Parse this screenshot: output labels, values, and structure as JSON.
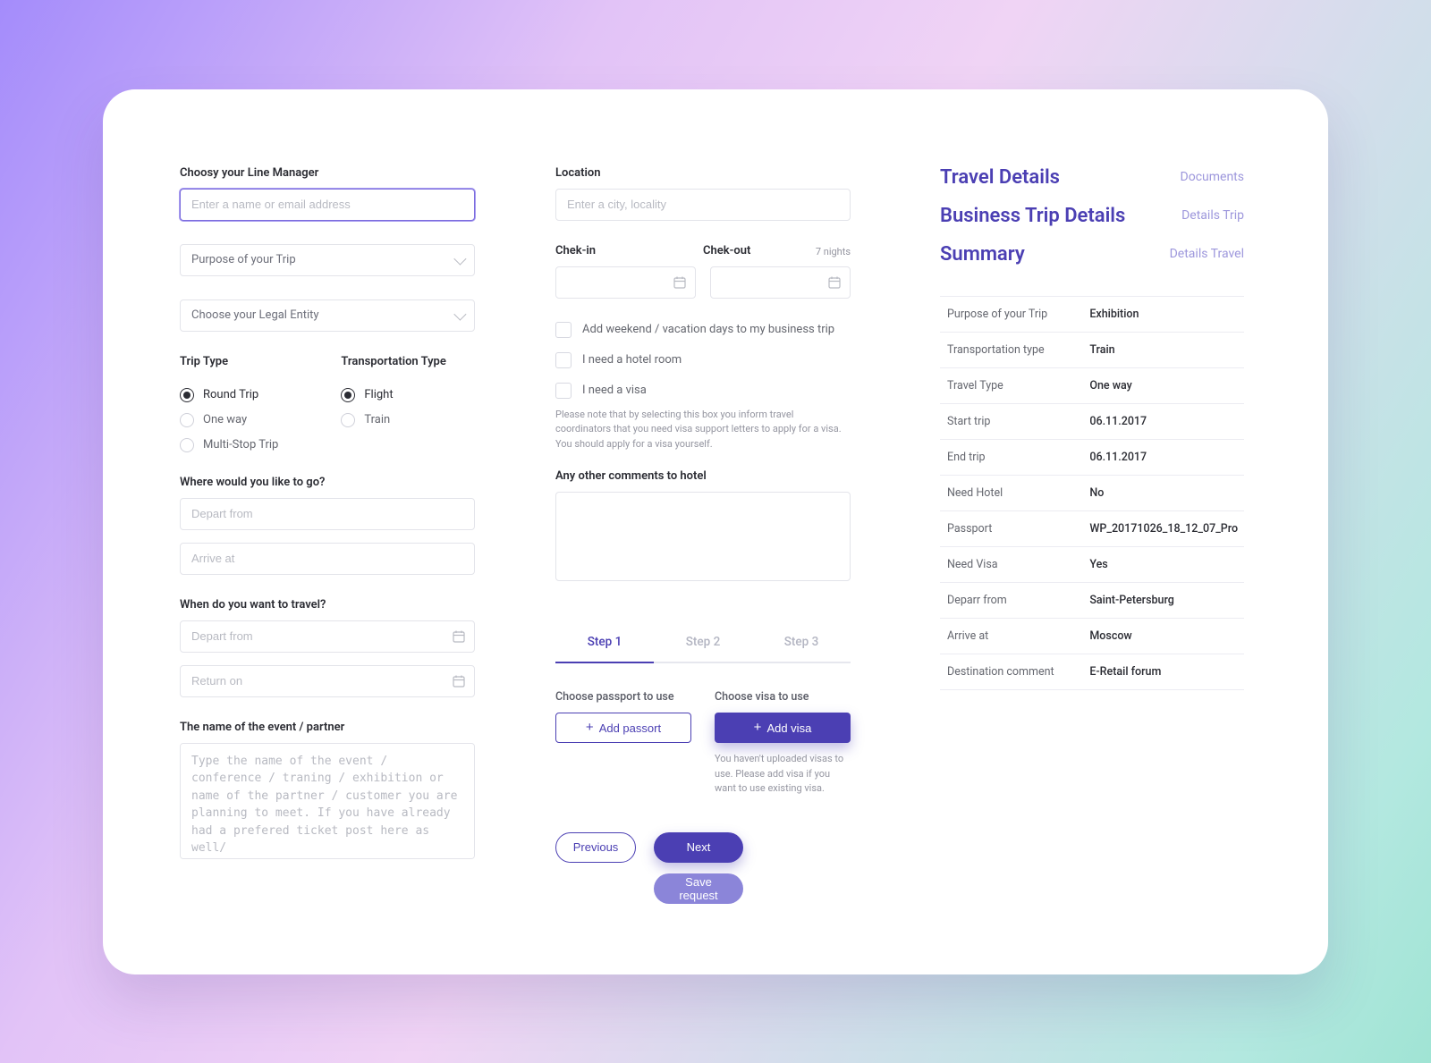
{
  "left": {
    "lineManager": {
      "label": "Choosy your Line Manager",
      "placeholder": "Enter a name or email address"
    },
    "purpose": {
      "placeholder": "Purpose of your Trip"
    },
    "legalEntity": {
      "placeholder": "Choose your Legal Entity"
    },
    "tripType": {
      "label": "Trip Type",
      "options": [
        "Round Trip",
        "One way",
        "Multi-Stop Trip"
      ],
      "selected": 0
    },
    "transportType": {
      "label": "Transportation Type",
      "options": [
        "Flight",
        "Train"
      ],
      "selected": 0
    },
    "where": {
      "label": "Where would you like to go?",
      "departPlaceholder": "Depart from",
      "arrivePlaceholder": "Arrive at"
    },
    "when": {
      "label": "When do you want to travel?",
      "departPlaceholder": "Depart from",
      "returnPlaceholder": "Return on"
    },
    "event": {
      "label": "The name of the event / partner",
      "placeholder": "Type the name of the event / conference / traning / exhibition or name of the partner / customer you are planning to meet. If you have already had a prefered ticket post here as well/"
    }
  },
  "mid": {
    "location": {
      "label": "Location",
      "placeholder": "Enter a city, locality"
    },
    "checkin": {
      "label": "Chek-in"
    },
    "checkout": {
      "label": "Chek-out"
    },
    "nights": "7 nights",
    "checks": {
      "weekend": "Add weekend / vacation days to my business trip",
      "hotel": "I need a hotel room",
      "visa": "I need a visa"
    },
    "visaNote": "Please note that by selecting this box you inform travel coordinators that you need visa support letters to apply for a visa. You should apply for a visa yourself.",
    "comments": {
      "label": "Any other comments to hotel"
    },
    "steps": [
      "Step 1",
      "Step 2",
      "Step 3"
    ],
    "passport": {
      "label": "Choose passport to use",
      "button": "Add passort"
    },
    "visa": {
      "label": "Choose visa to use",
      "button": "Add visa",
      "note": "You haven't uploaded visas to use. Please add visa if you want to use existing visa."
    },
    "prev": "Previous",
    "next": "Next",
    "save": "Save request"
  },
  "right": {
    "head": [
      {
        "title": "Travel Details",
        "sub": "Documents"
      },
      {
        "title": "Business Trip Details",
        "sub": "Details Trip"
      },
      {
        "title": "Summary",
        "sub": "Details Travel"
      }
    ],
    "rows": [
      {
        "k": "Purpose of your Trip",
        "v": "Exhibition"
      },
      {
        "k": "Transportation type",
        "v": "Train"
      },
      {
        "k": "Travel Type",
        "v": "One way"
      },
      {
        "k": "Start trip",
        "v": "06.11.2017"
      },
      {
        "k": "End trip",
        "v": "06.11.2017"
      },
      {
        "k": "Need Hotel",
        "v": "No"
      },
      {
        "k": "Passport",
        "v": "WP_20171026_18_12_07_Pro"
      },
      {
        "k": "Need Visa",
        "v": "Yes"
      },
      {
        "k": "Deparr from",
        "v": "Saint-Petersburg"
      },
      {
        "k": "Arrive at",
        "v": "Moscow"
      },
      {
        "k": "Destination comment",
        "v": "E-Retail forum"
      }
    ]
  }
}
